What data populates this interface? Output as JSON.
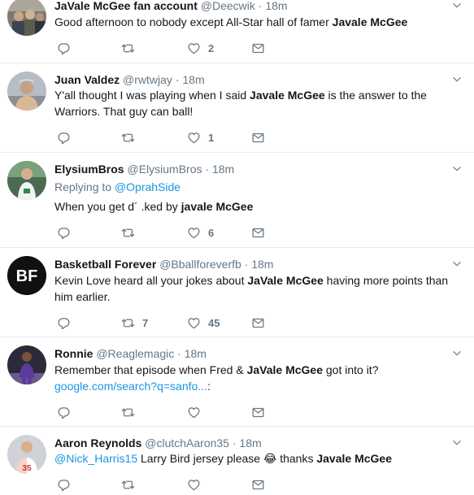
{
  "tweets": [
    {
      "name": "JaVale McGee fan account",
      "handle": "@Deecwik",
      "time": "18m",
      "replying_to": "",
      "text_before": "Good afternoon to nobody except All-Star hall of famer ",
      "text_bold": "Javale McGee",
      "text_after": "",
      "retweets": "",
      "likes": "2"
    },
    {
      "name": "Juan Valdez",
      "handle": "@rwtwjay",
      "time": "18m",
      "replying_to": "",
      "text_before": "Y'all thought I was playing when I said ",
      "text_bold": "Javale McGee",
      "text_after": " is the answer to the Warriors. That guy can ball!",
      "retweets": "",
      "likes": "1"
    },
    {
      "name": "ElysiumBros",
      "handle": "@ElysiumBros",
      "time": "18m",
      "replying_label": "Replying to ",
      "replying_to": "@OprahSide",
      "text_before": "When you get d´ .ked by ",
      "text_bold": "javale McGee",
      "text_after": "",
      "retweets": "",
      "likes": "6"
    },
    {
      "name": "Basketball Forever",
      "handle": "@Bballforeverfb",
      "time": "18m",
      "replying_to": "",
      "avatar_text": "BF",
      "text_before": "Kevin Love heard all your jokes about ",
      "text_bold": "JaVale McGee",
      "text_after": " having more points than him earlier.",
      "retweets": "7",
      "likes": "45"
    },
    {
      "name": "Ronnie",
      "handle": "@Reaglemagic",
      "time": "18m",
      "replying_to": "",
      "text_before": "Remember that episode when Fred & ",
      "text_bold": "JaVale McGee",
      "text_after": " got into it?",
      "link": "google.com/search?q=sanfo...",
      "link_suffix": ":",
      "retweets": "",
      "likes": ""
    },
    {
      "name": "Aaron Reynolds",
      "handle": "@clutchAaron35",
      "time": "18m",
      "replying_to": "",
      "mention": "@Nick_Harris15",
      "text_before": " Larry Bird jersey please ",
      "emoji": "😂",
      "text_middle": " thanks ",
      "text_bold": "Javale McGee",
      "text_after": "",
      "jersey_number": "35",
      "retweets": "",
      "likes": ""
    }
  ],
  "separator": "·",
  "icons": {
    "reply": "reply-icon",
    "retweet": "retweet-icon",
    "like": "heart-icon",
    "dm": "envelope-icon",
    "caret": "chevron-down-icon"
  },
  "colors": {
    "link": "#1b95e0",
    "muted": "#657786",
    "border": "#e6ecf0"
  }
}
